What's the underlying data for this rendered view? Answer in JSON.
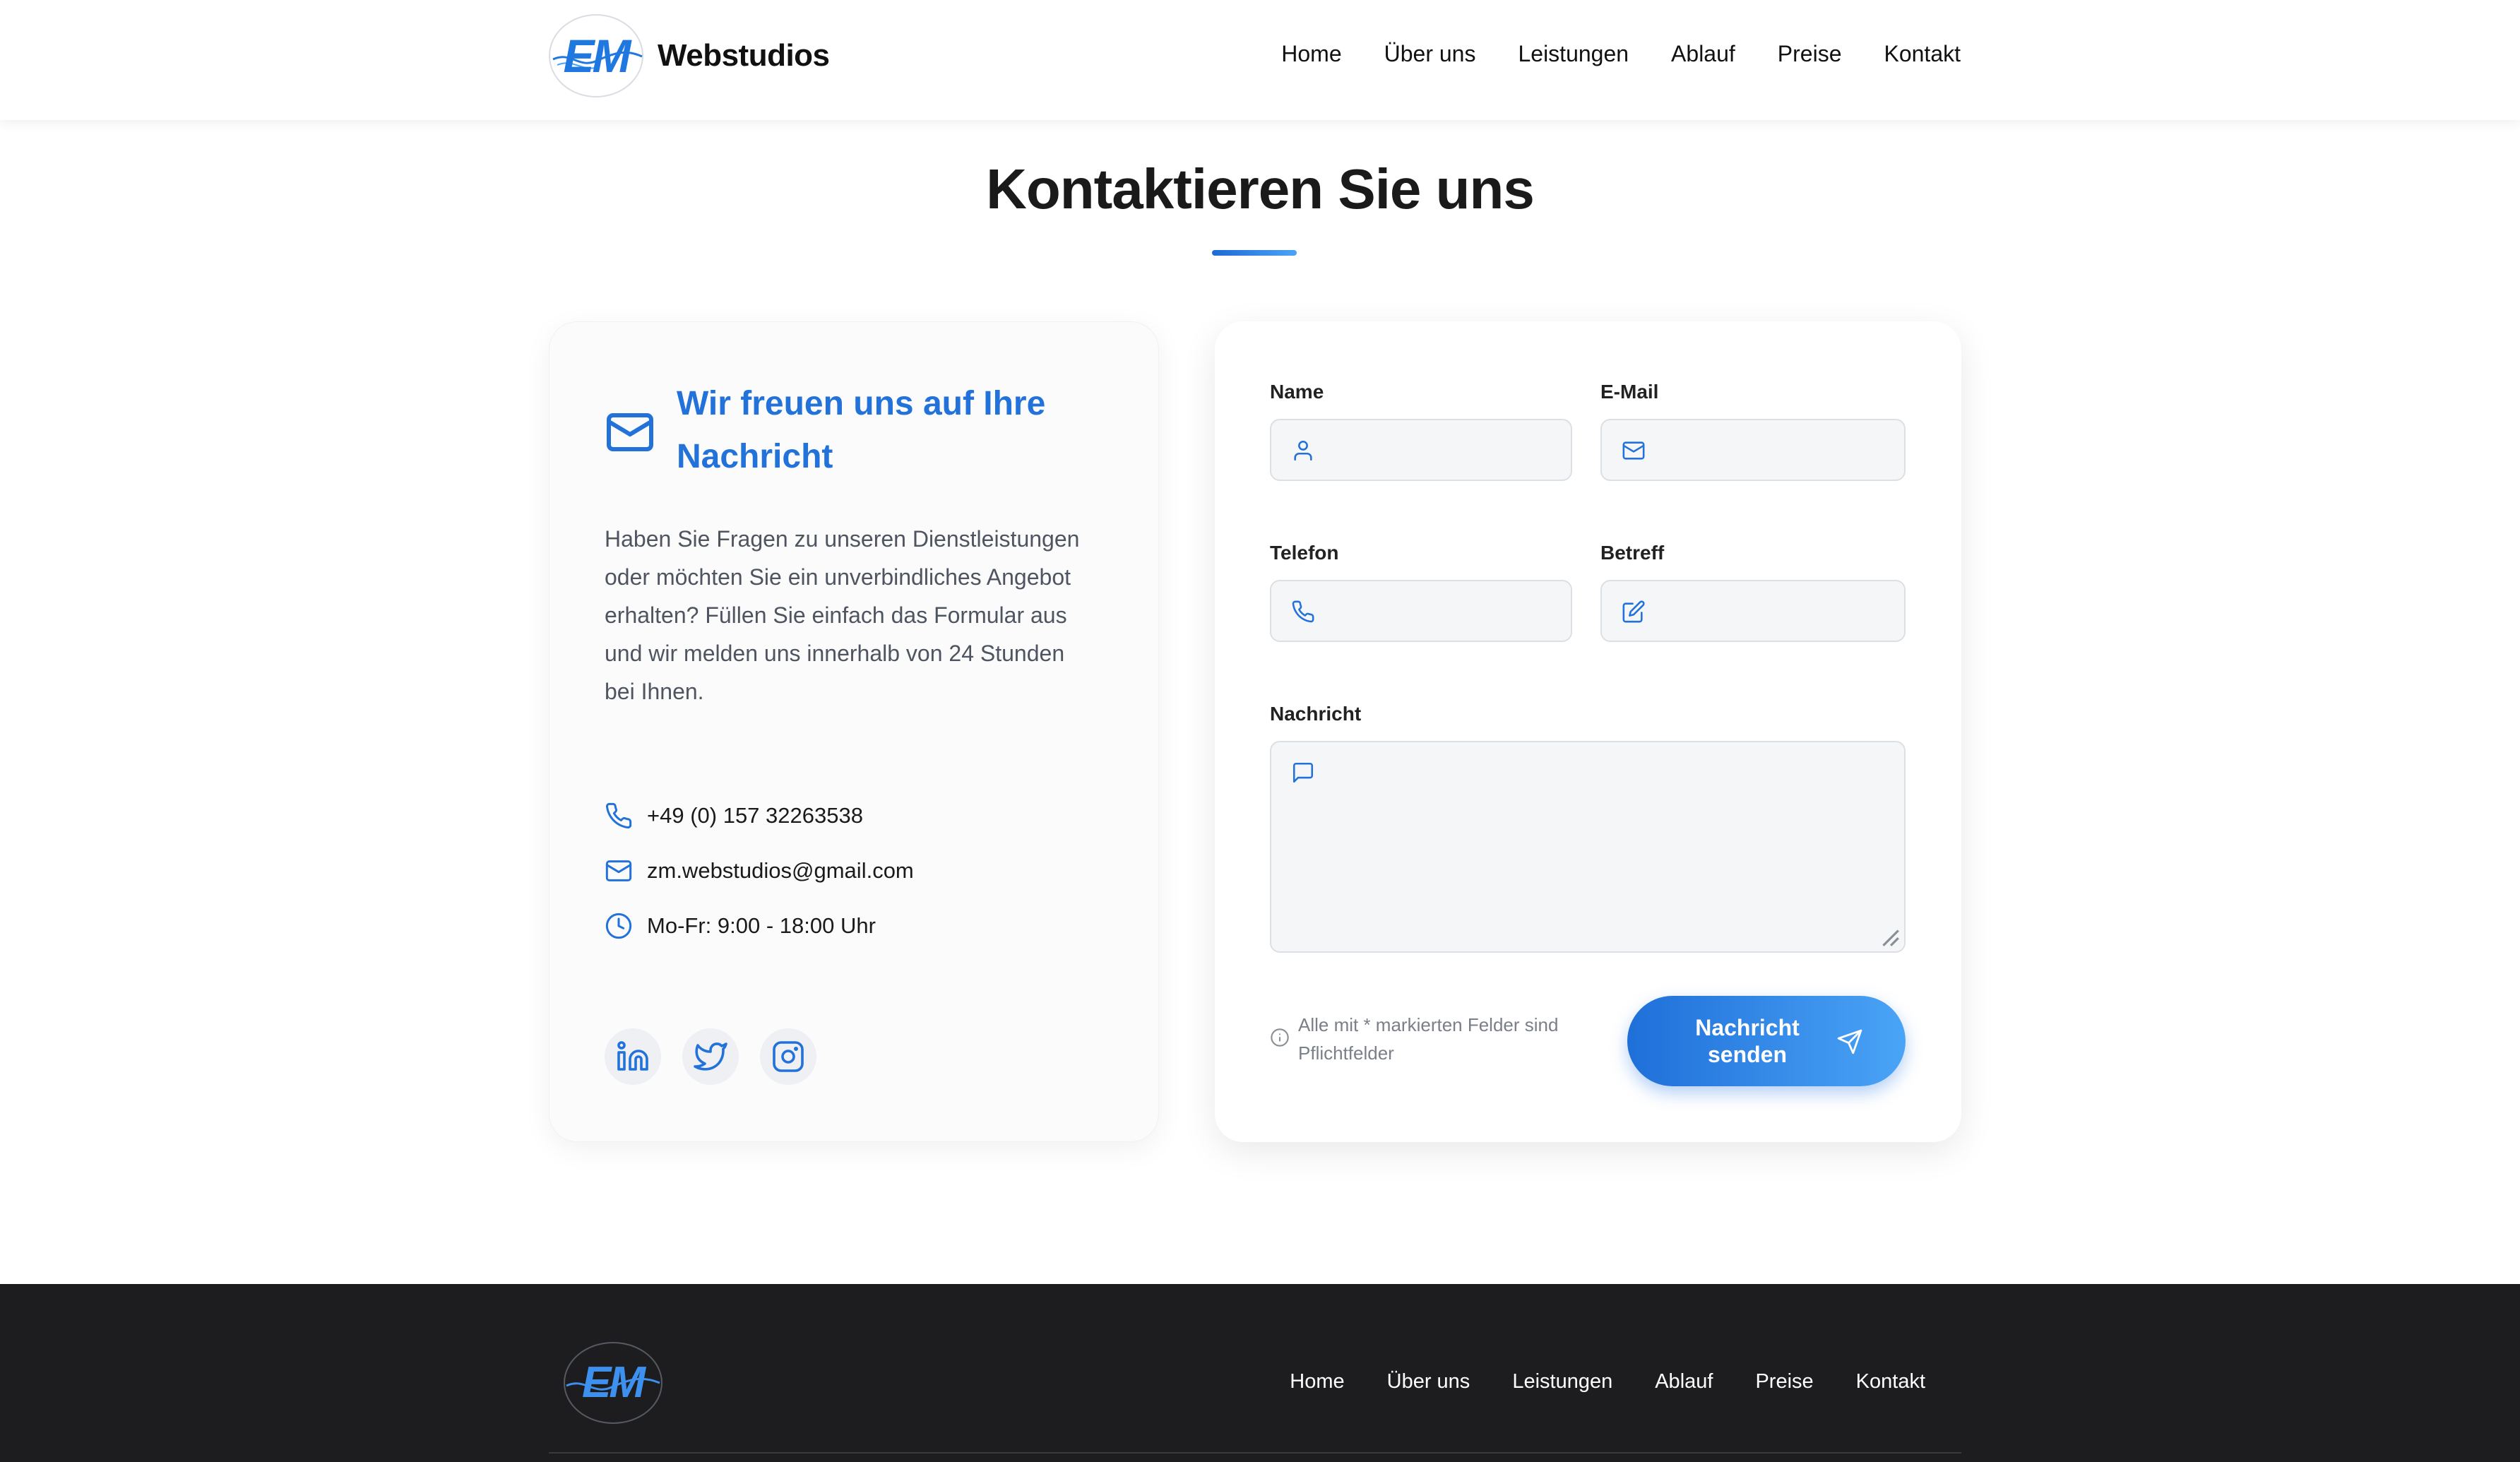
{
  "header": {
    "logo_text": "EM",
    "brand_name": "Webstudios",
    "nav": [
      "Home",
      "Über uns",
      "Leistungen",
      "Ablauf",
      "Preise",
      "Kontakt"
    ]
  },
  "main": {
    "title": "Kontaktieren Sie uns"
  },
  "info_card": {
    "title": "Wir freuen uns auf Ihre Nachricht",
    "description": "Haben Sie Fragen zu unseren Dienstleistungen oder möchten Sie ein unverbindliches Angebot erhalten? Füllen Sie einfach das Formular aus und wir melden uns innerhalb von 24 Stunden bei Ihnen.",
    "phone": "+49 (0) 157 32263538",
    "email": "zm.webstudios@gmail.com",
    "hours": "Mo-Fr: 9:00 - 18:00 Uhr",
    "socials": [
      "linkedin-icon",
      "twitter-icon",
      "instagram-icon"
    ]
  },
  "form": {
    "name_label": "Name",
    "email_label": "E-Mail",
    "phone_label": "Telefon",
    "subject_label": "Betreff",
    "message_label": "Nachricht",
    "name_value": "",
    "email_value": "",
    "phone_value": "",
    "subject_value": "",
    "message_value": "",
    "note": "Alle mit * markierten Felder sind Pflichtfelder",
    "submit_label": "Nachricht senden"
  },
  "footer": {
    "logo_text": "EM",
    "nav": [
      "Home",
      "Über uns",
      "Leistungen",
      "Ablauf",
      "Preise",
      "Kontakt"
    ]
  },
  "colors": {
    "accent": "#2272d9",
    "button_gradient_start": "#1f6fd9",
    "button_gradient_end": "#4aa4f6",
    "footer_bg": "#1d1d1f"
  }
}
